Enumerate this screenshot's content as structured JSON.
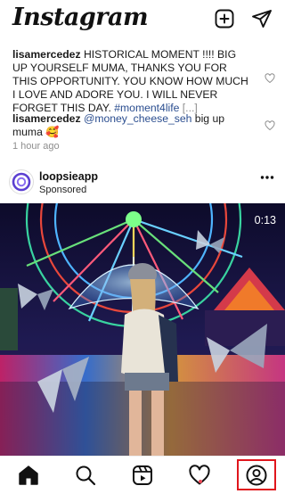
{
  "header": {
    "logo": "Instagram",
    "new_post_icon": "plus-square-icon",
    "direct_icon": "paper-plane-icon"
  },
  "comments": [
    {
      "user": "lisamercedez",
      "text": " HISTORICAL MOMENT !!!! BIG UP YOURSELF MUMA, THANKS  YOU FOR THIS OPPORTUNITY. YOU KNOW HOW MUCH I LOVE AND ADORE YOU. I WILL NEVER FORGET THIS DAY. ",
      "hashtag": "#moment4life",
      "more": " [...]"
    },
    {
      "user": "lisamercedez",
      "mention": " @money_cheese_seh",
      "text": " big up muma 🥰"
    }
  ],
  "timestamp": "1 hour ago",
  "post": {
    "username": "loopsieapp",
    "sponsored_label": "Sponsored",
    "duration": "0:13"
  },
  "nav": [
    "home-icon",
    "search-icon",
    "reels-icon",
    "activity-heart-icon",
    "profile-icon"
  ],
  "colors": {
    "accent_red": "#e0161d",
    "link_blue": "#2a4d8f",
    "muted": "#8e8e8e",
    "notification": "#ed4956"
  }
}
